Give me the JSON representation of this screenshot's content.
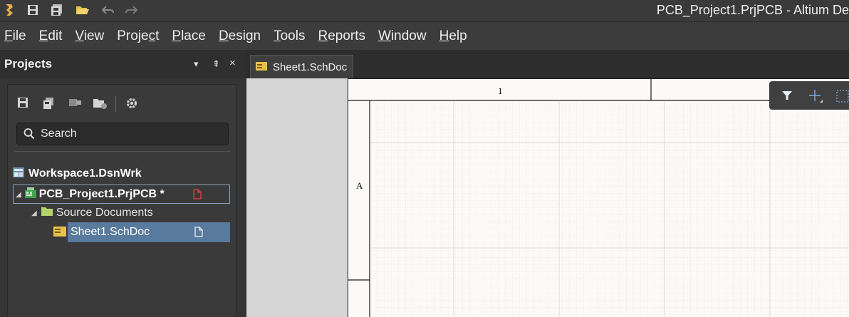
{
  "titlebar": {
    "title": "PCB_Project1.PrjPCB - Altium De",
    "quick_access": [
      "app-logo",
      "save-icon",
      "save-all-icon",
      "open-folder-icon",
      "undo-icon",
      "redo-icon"
    ]
  },
  "menu": [
    {
      "label": "File",
      "mnemonic": "F"
    },
    {
      "label": "Edit",
      "mnemonic": "E"
    },
    {
      "label": "View",
      "mnemonic": "V"
    },
    {
      "label": "Project",
      "mnemonic": "c"
    },
    {
      "label": "Place",
      "mnemonic": "P"
    },
    {
      "label": "Design",
      "mnemonic": "D"
    },
    {
      "label": "Tools",
      "mnemonic": "T"
    },
    {
      "label": "Reports",
      "mnemonic": "R"
    },
    {
      "label": "Window",
      "mnemonic": "W"
    },
    {
      "label": "Help",
      "mnemonic": "H"
    }
  ],
  "projects_panel": {
    "title": "Projects",
    "controls": [
      "▾",
      "⇞",
      "×"
    ],
    "search_placeholder": "Search",
    "tree": {
      "workspace": "Workspace1.DsnWrk",
      "project": "PCB_Project1.PrjPCB *",
      "folder": "Source Documents",
      "document": "Sheet1.SchDoc"
    }
  },
  "doc_tabs": [
    {
      "label": "Sheet1.SchDoc",
      "active": true
    }
  ],
  "sheet": {
    "column_label": "1",
    "row_label": "A"
  },
  "colors": {
    "accent_select": "#4d6b8a",
    "selected_row": "#587a9c",
    "folder_yellow": "#e8c14a",
    "project_green": "#3fa34d",
    "doc_marker_red": "#e64040"
  }
}
